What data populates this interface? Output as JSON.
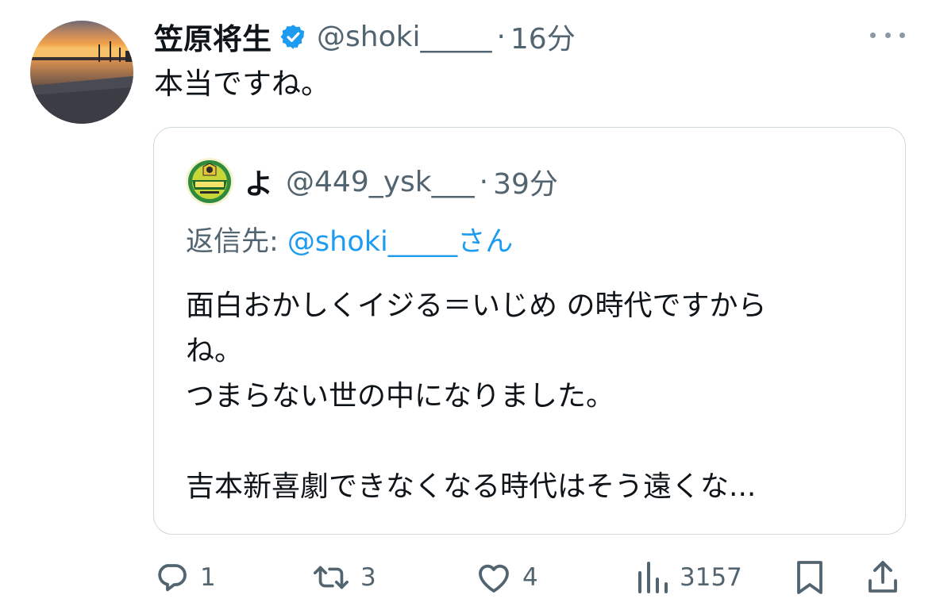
{
  "tweet": {
    "author": {
      "display_name": "笠原将生",
      "handle": "@shoki_____",
      "verified": true,
      "avatar": "sunset-harbor-avatar"
    },
    "separator": "·",
    "time": "16分",
    "more_icon": "more-horizontal-icon",
    "text": "本当ですね。"
  },
  "quoted": {
    "author": {
      "display_name": "よ",
      "handle": "@449_ysk___",
      "avatar": "champions-badge-avatar"
    },
    "separator": "·",
    "time": "39分",
    "reply_prefix": "返信先: ",
    "reply_mention": "@shoki_____さん",
    "lines": [
      "面白おかしくイジる＝いじめ の時代ですから",
      "ね。",
      "つまらない世の中になりました。",
      "",
      "吉本新喜劇できなくなる時代はそう遠くな..."
    ]
  },
  "actions": {
    "reply": {
      "icon": "reply-icon",
      "count": "1"
    },
    "retweet": {
      "icon": "retweet-icon",
      "count": "3"
    },
    "like": {
      "icon": "heart-icon",
      "count": "4"
    },
    "views": {
      "icon": "views-chart-icon",
      "count": "3157"
    },
    "bookmark": {
      "icon": "bookmark-icon"
    },
    "share": {
      "icon": "share-icon"
    }
  },
  "colors": {
    "text": "#0f1419",
    "secondary": "#536471",
    "link": "#1d9bf0",
    "verified": "#1d9bf0",
    "border": "#cfd9de"
  }
}
